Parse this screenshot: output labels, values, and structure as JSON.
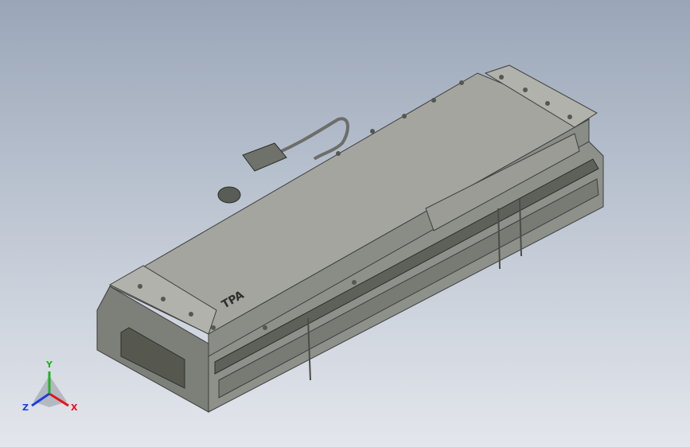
{
  "viewport": {
    "background_top": "#9aa6b8",
    "background_bottom": "#e3e6ec"
  },
  "model": {
    "body_color": "#8a8c86",
    "top_color": "#a3a59e",
    "edge_color": "#3d3f3c",
    "logo_text": "TPA"
  },
  "triad": {
    "x_label": "X",
    "y_label": "Y",
    "z_label": "Z",
    "x_color": "#e0161b",
    "y_color": "#1fb31f",
    "z_color": "#1c3fe0"
  }
}
